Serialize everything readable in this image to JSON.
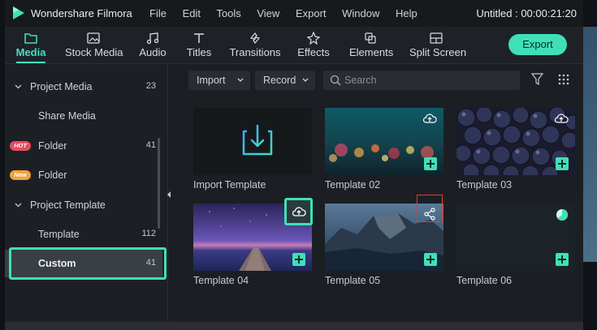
{
  "app": {
    "name": "Wondershare Filmora",
    "project_title": "Untitled : 00:00:21:20"
  },
  "menu": [
    "File",
    "Edit",
    "Tools",
    "View",
    "Export",
    "Window",
    "Help"
  ],
  "toolbar": {
    "tabs": [
      {
        "label": "Media",
        "icon": "folder-icon",
        "active": true
      },
      {
        "label": "Stock Media",
        "icon": "image-icon"
      },
      {
        "label": "Audio",
        "icon": "music-note-icon"
      },
      {
        "label": "Titles",
        "icon": "text-icon"
      },
      {
        "label": "Transitions",
        "icon": "transitions-icon"
      },
      {
        "label": "Effects",
        "icon": "effects-icon"
      },
      {
        "label": "Elements",
        "icon": "elements-icon"
      },
      {
        "label": "Split Screen",
        "icon": "split-screen-icon"
      }
    ],
    "export_label": "Export",
    "accent": "#3fe0b8"
  },
  "sidebar": {
    "items": [
      {
        "label": "Project Media",
        "count": "23",
        "expanded": true
      },
      {
        "label": "Share Media",
        "count": ""
      },
      {
        "label": "Folder",
        "count": "41",
        "badge": "HOT"
      },
      {
        "label": "Folder",
        "count": "",
        "badge": "New"
      },
      {
        "label": "Project Template",
        "count": "",
        "expanded": true
      },
      {
        "label": "Template",
        "count": "112"
      },
      {
        "label": "Custom",
        "count": "41",
        "selected": true
      }
    ]
  },
  "content": {
    "import_label": "Import",
    "record_label": "Record",
    "search_placeholder": "Search",
    "cards": [
      {
        "name": "Import Template",
        "type": "import"
      },
      {
        "name": "Template 02",
        "type": "bokeh",
        "cloud": true,
        "plus": true
      },
      {
        "name": "Template 03",
        "type": "blueberries",
        "cloud": true,
        "plus": true
      },
      {
        "name": "Template 04",
        "type": "pier",
        "plus": true
      },
      {
        "name": "Template 05",
        "type": "mountains",
        "share": true,
        "plus": true
      },
      {
        "name": "Template 06",
        "type": "dark",
        "plus": true,
        "progress": 0.7
      }
    ]
  }
}
